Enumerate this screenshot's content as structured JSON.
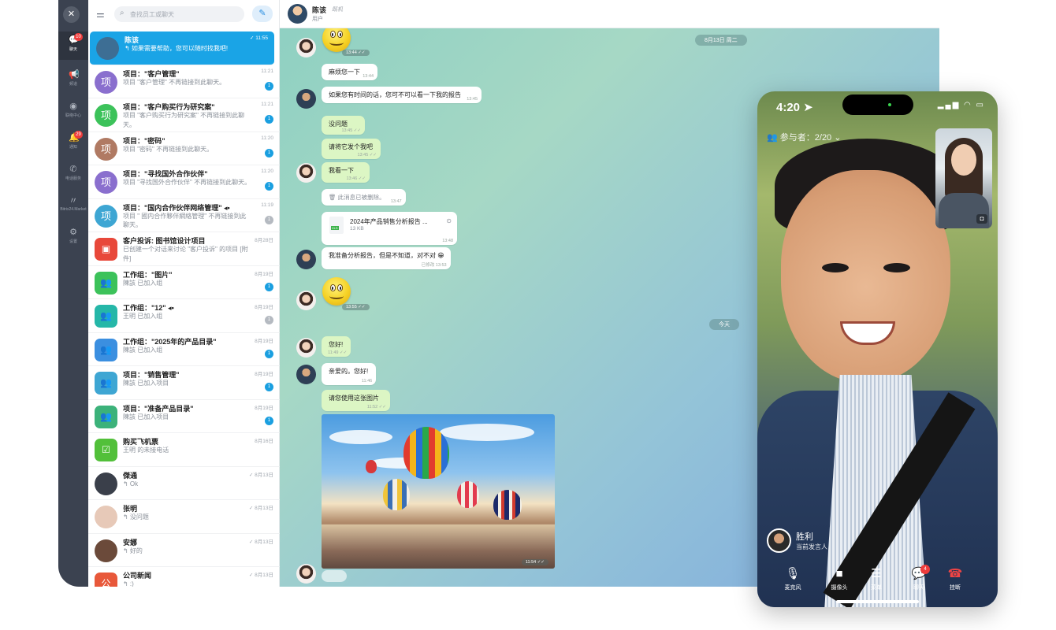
{
  "rail": {
    "items": [
      {
        "label": "聊天",
        "icon": "chat-icon",
        "badge": "10"
      },
      {
        "label": "频道",
        "icon": "megaphone-icon",
        "badge": ""
      },
      {
        "label": "联络中心",
        "icon": "contact-center-icon",
        "badge": ""
      },
      {
        "label": "通知",
        "icon": "bell-icon",
        "badge": "29"
      },
      {
        "label": "电话服务",
        "icon": "phone-icon",
        "badge": ""
      },
      {
        "label": "Bitrix24.Market",
        "icon": "market-icon",
        "badge": ""
      },
      {
        "label": "设置",
        "icon": "gear-icon",
        "badge": ""
      }
    ]
  },
  "search": {
    "placeholder": "查找员工或聊天"
  },
  "chats": [
    {
      "title": "陈该",
      "msg": "↰ 如果需要帮助，您可以随时找我吧!",
      "time": "✓ 11:55",
      "badge": "",
      "avatar": "",
      "color": "#3d6e94"
    },
    {
      "title": "项目：\"客户管理\"",
      "msg": "项目 \"客户管理\" 不再链接到此聊天。",
      "time": "11:21",
      "badge": "1",
      "avatar": "项",
      "color": "#8a6fce"
    },
    {
      "title": "项目：\"客户购买行为研究案\"",
      "msg": "项目 \"客户购买行为研究案\" 不再链接到此聊天。",
      "time": "11:21",
      "badge": "1",
      "avatar": "项",
      "color": "#3cc25a"
    },
    {
      "title": "项目：\"密码\"",
      "msg": "项目 \"密码\" 不再链接到此聊天。",
      "time": "11:20",
      "badge": "1",
      "avatar": "项",
      "color": "#b07a63"
    },
    {
      "title": "项目：\"寻找国外合作伙伴\"",
      "msg": "项目 \"寻找国外合作伙伴\" 不再链接到此聊天。",
      "time": "11:20",
      "badge": "1",
      "avatar": "项",
      "color": "#8a6fce"
    },
    {
      "title": "项目：\"国内合作伙伴网络管理\" ◂•",
      "msg": "项目 \" 國内合作夥伴網絡管理\" 不再链接到此聊天。",
      "time": "11:19",
      "badge": "1",
      "avatar": "项",
      "color": "#3ea6d3",
      "badge_grey": true
    },
    {
      "title": "客户投诉: 图书馆设计项目",
      "msg": "已创建一个对话来讨论 \"客户投诉\" 的项目 [附件]",
      "time": "8月28日",
      "badge": "",
      "avatar": "▣",
      "color": "#e8483a",
      "square": true
    },
    {
      "title": "工作组：\"图片\"",
      "msg": "陳該 已加入组",
      "time": "8月19日",
      "badge": "1",
      "avatar": "👥",
      "color": "#3cc25a",
      "square": true
    },
    {
      "title": "工作组：\"12\" ◂•",
      "msg": "王明 已加入组",
      "time": "8月19日",
      "badge": "1",
      "avatar": "👥",
      "color": "#25b7a8",
      "square": true,
      "badge_grey": true
    },
    {
      "title": "工作组：\"2025年的产品目录\"",
      "msg": "陳該 已加入组",
      "time": "8月19日",
      "badge": "1",
      "avatar": "👥",
      "color": "#3b8fe0",
      "square": true
    },
    {
      "title": "项目：\"销售管理\"",
      "msg": "陳該 已加入项目",
      "time": "8月19日",
      "badge": "1",
      "avatar": "👥",
      "color": "#3ea6d3",
      "square": true
    },
    {
      "title": "项目：\"准备产品目录\"",
      "msg": "陳該 已加入项目",
      "time": "8月19日",
      "badge": "1",
      "avatar": "👥",
      "color": "#3cb27a",
      "square": true
    },
    {
      "title": "购买飞机票",
      "msg": "王明 的未接电话",
      "time": "8月16日",
      "badge": "",
      "avatar": "☑",
      "color": "#52c03a",
      "square": true
    },
    {
      "title": "傑通",
      "msg": "↰ Ok",
      "time": "✓ 8月13日",
      "badge": "",
      "avatar": "",
      "color": "#3a3f4a"
    },
    {
      "title": "张明",
      "msg": "↰ 没问题",
      "time": "✓ 8月13日",
      "badge": "",
      "avatar": "",
      "color": "#e7c9b8"
    },
    {
      "title": "安娜",
      "msg": "↰ 好的",
      "time": "✓ 8月13日",
      "badge": "",
      "avatar": "",
      "color": "#6b4a3a"
    },
    {
      "title": "公司新闻",
      "msg": "↰ :)",
      "time": "✓ 8月13日",
      "badge": "",
      "avatar": "公",
      "color": "#e8583a",
      "square": true
    }
  ],
  "header": {
    "name": "陈该",
    "status": "既机",
    "role": "用户"
  },
  "messages": {
    "date_1": "8月13日 周二",
    "date_2": "今天",
    "m1": {
      "text": "麻烦您一下",
      "time": "13:44"
    },
    "m2": {
      "text": "如果您有时间的话，您可不可以看一下我的报告",
      "time": "13:45"
    },
    "m3": {
      "text": "没问题",
      "time": "13:45 ✓✓"
    },
    "m4": {
      "text": "请将它发个我吧",
      "time": "13:45 ✓✓"
    },
    "m5": {
      "text": "我看一下",
      "time": "13:46 ✓✓"
    },
    "m6": {
      "text": "🗑 此消息已被删除。",
      "time": "13:47"
    },
    "file": {
      "name": "2024年产品销售分析报告 ...",
      "size": "13 KB",
      "time": "13:48",
      "ext": "XLS"
    },
    "m7": {
      "text": "我准备分析报告，但是不知道，对不对 😁",
      "time": "已修改 13:53"
    },
    "sticker1_time": "13:44 ✓✓",
    "sticker2_time": "13:55 ✓✓",
    "m8": {
      "text": "您好!",
      "time": "11:49 ✓✓"
    },
    "m9": {
      "text": "亲爱的。您好!",
      "time": "11:46"
    },
    "m10": {
      "text": "请您使用这张图片",
      "time": "11:52 ✓✓"
    },
    "photo_time": "11:54 ✓✓"
  },
  "phone": {
    "time": "4:20 ➤",
    "signal": "▂▄▆ ◠ ▭",
    "participants": "参与者：2/20 ⌄",
    "speaker_name": "胜利",
    "speaker_role": "当前发言人",
    "controls": [
      {
        "label": "麦克风",
        "icon": "microphone-icon",
        "glyph": "🎙"
      },
      {
        "label": "摄像头",
        "icon": "camera-icon",
        "glyph": "■"
      },
      {
        "label": "菜单",
        "icon": "menu-icon",
        "glyph": "☰"
      },
      {
        "label": "聊天",
        "icon": "chat-icon",
        "glyph": "💬",
        "badge": "4"
      },
      {
        "label": "挂断",
        "icon": "hangup-icon",
        "glyph": "☎"
      }
    ]
  }
}
